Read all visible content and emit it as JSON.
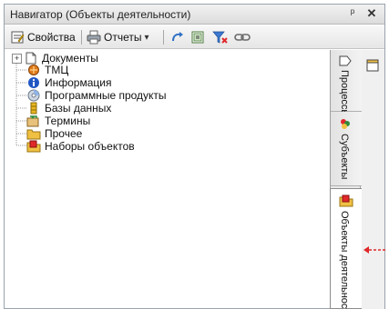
{
  "window": {
    "title": "Навигатор (Объекты деятельности)",
    "pin_glyph": "ᵖ",
    "close_glyph": "✕"
  },
  "toolbar": {
    "properties_label": "Свойства",
    "reports_label": "Отчеты",
    "reports_dropdown_glyph": "▾"
  },
  "tree": {
    "items": [
      {
        "label": "Документы",
        "icon": "document-icon",
        "expander": "⊞"
      },
      {
        "label": "ТМЦ",
        "icon": "goods-icon"
      },
      {
        "label": "Информация",
        "icon": "info-icon"
      },
      {
        "label": "Программные продукты",
        "icon": "software-icon"
      },
      {
        "label": "Базы данных",
        "icon": "database-icon"
      },
      {
        "label": "Термины",
        "icon": "terms-icon"
      },
      {
        "label": "Прочее",
        "icon": "folder-icon"
      },
      {
        "label": "Наборы объектов",
        "icon": "object-sets-icon"
      }
    ]
  },
  "side_tabs": [
    {
      "label": "Процессы",
      "icon": "processes-icon",
      "active": false
    },
    {
      "label": "Субъекты",
      "icon": "subjects-icon",
      "active": false
    },
    {
      "label": "Объекты деятельности",
      "icon": "objects-icon",
      "active": true
    }
  ],
  "colors": {
    "accent_arrow": "#e0282b",
    "tree_line": "#9a9a9a"
  }
}
